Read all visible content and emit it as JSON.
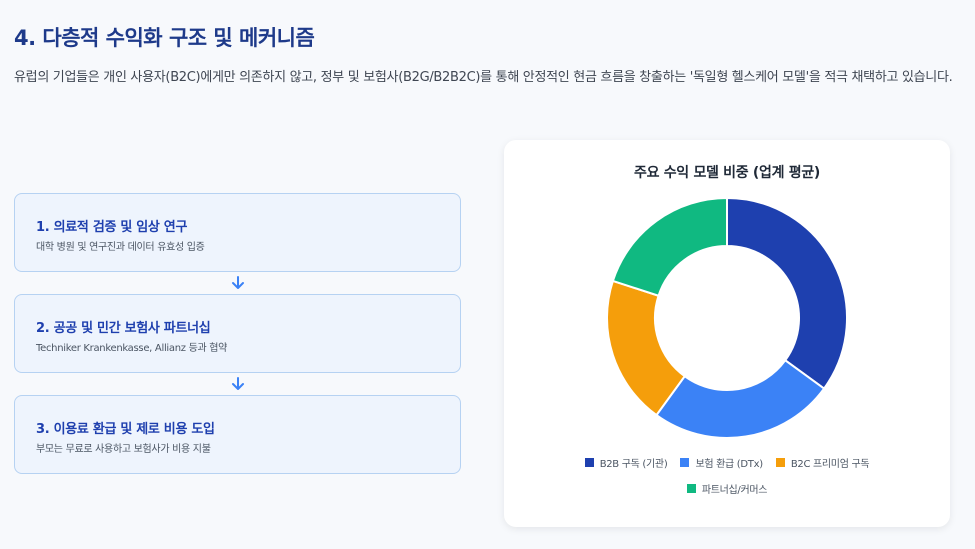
{
  "section": {
    "title": "4. 다층적 수익화 구조 및 메커니즘",
    "intro": "유럽의 기업들은 개인 사용자(B2C)에게만 의존하지 않고, 정부 및 보험사(B2G/B2B2C)를 통해 안정적인 현금 흐름을 창출하는 '독일형 헬스케어 모델'을 적극 채택하고 있습니다."
  },
  "steps": [
    {
      "title": "1. 의료적 검증 및 임상 연구",
      "desc": "대학 병원 및 연구진과 데이터 유효성 입증"
    },
    {
      "title": "2. 공공 및 민간 보험사 파트너십",
      "desc": "Techniker Krankenkasse, Allianz 등과 협약"
    },
    {
      "title": "3. 이용료 환급 및 제로 비용 도입",
      "desc": "부모는 무료로 사용하고 보험사가 비용 지불"
    }
  ],
  "icons": {
    "step_arrow": "arrow-down-icon"
  },
  "chart_data": {
    "type": "pie",
    "title": "주요 수익 모델 비중 (업계 평균)",
    "categories": [
      "B2B 구독 (기관)",
      "보험 환급 (DTx)",
      "B2C 프리미엄 구독",
      "파트너십/커머스"
    ],
    "values": [
      35,
      25,
      20,
      20
    ],
    "colors": [
      "#1e40af",
      "#3b82f6",
      "#f59e0b",
      "#10b981"
    ],
    "donut": true,
    "legend_position": "bottom"
  }
}
